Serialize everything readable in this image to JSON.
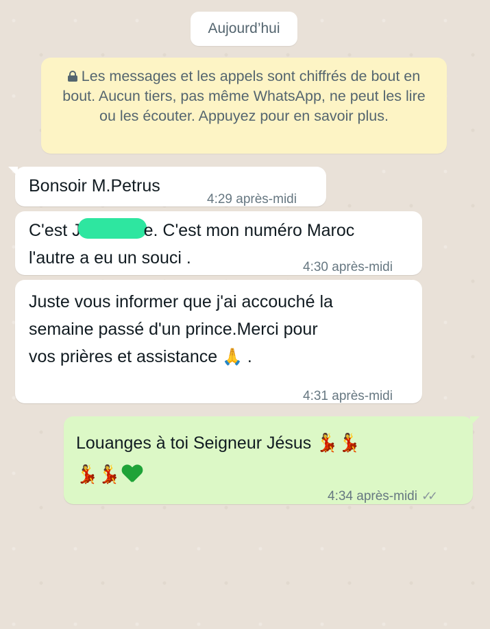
{
  "date_label": "Aujourd’hui",
  "encryption_notice": "Les messages et les appels sont chiffrés de bout en bout. Aucun tiers, pas même WhatsApp, ne peut les lire ou les écouter. Appuyez pour en savoir plus.",
  "messages": [
    {
      "direction": "in",
      "text": "Bonsoir M.Petrus",
      "time": "4:29 après-midi"
    },
    {
      "direction": "in",
      "text_before": "C'est J",
      "text_after": "e. C'est mon numéro Maroc",
      "text_line2": "l'autre a eu un souci .",
      "time": "4:30 après-midi"
    },
    {
      "direction": "in",
      "text": "Juste vous informer que j'ai accouché la\nsemaine passé d'un prince.Merci pour\nvos prières et assistance",
      "emoji": "🙏",
      "text_end": ".",
      "time": "4:31 après-midi"
    },
    {
      "direction": "out",
      "text": "Louanges à toi Seigneur Jésus",
      "emoji_line1": "💃💃",
      "emoji_line2": "💃💃",
      "time": "4:34 après-midi",
      "status": "read"
    }
  ],
  "colors": {
    "incoming": "#ffffff",
    "outgoing": "#dcf8c6",
    "notice": "#fdf4c5",
    "wallpaper": "#e9e1d8"
  }
}
